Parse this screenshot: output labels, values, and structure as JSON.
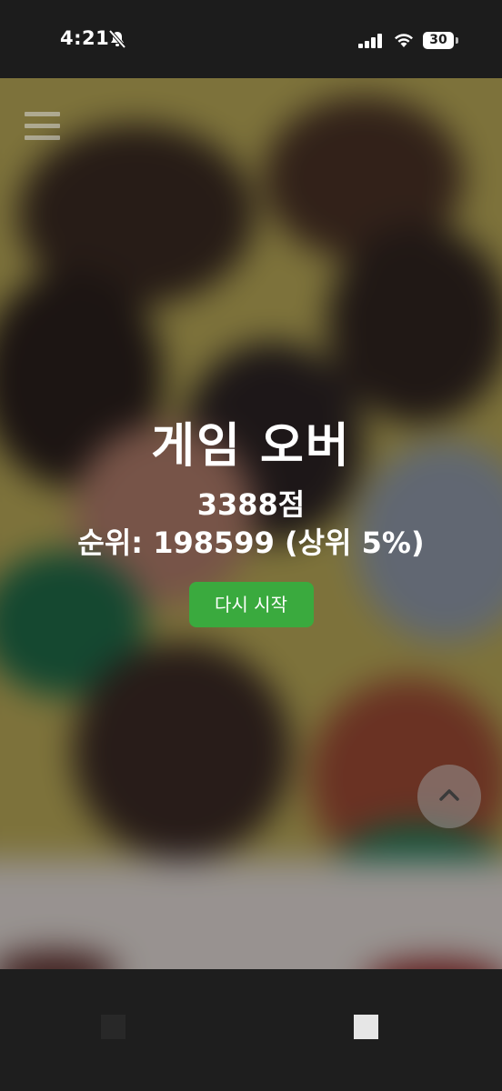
{
  "status_bar": {
    "time": "4:21",
    "battery": "30",
    "icons": [
      "mute-icon",
      "signal-icon",
      "wifi-icon",
      "battery-icon"
    ]
  },
  "menu": {
    "icon": "hamburger-menu-icon"
  },
  "game_over": {
    "title": "게임 오버",
    "score": "3388점",
    "rank": "순위: 198599 (상위 5%)",
    "restart_label": "다시 시작"
  },
  "scroll_top": {
    "icon": "chevron-up-icon"
  },
  "colors": {
    "restart_button": "#3aaa3e",
    "status_bar_bg": "#1c1c1c",
    "text": "#ffffff"
  }
}
